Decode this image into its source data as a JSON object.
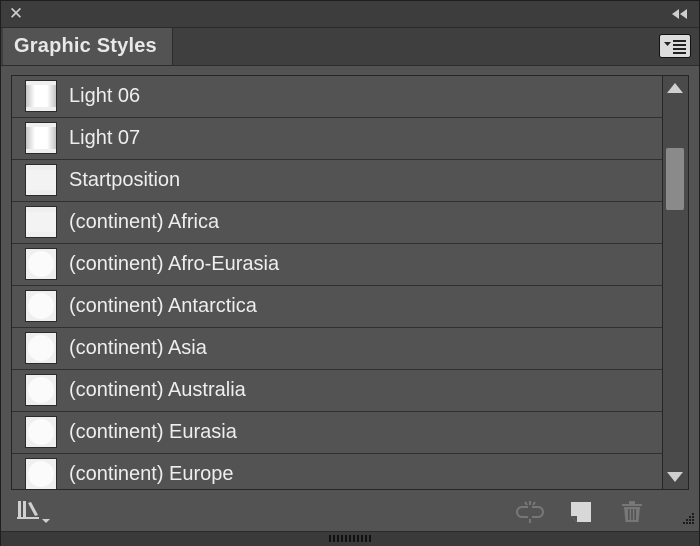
{
  "panel": {
    "tab_title": "Graphic Styles"
  },
  "icons": {
    "close": "close-icon",
    "collapse": "double-chevron-left-icon",
    "menu": "panel-menu-icon",
    "libraries": "graphic-styles-library-icon",
    "break_link": "break-link-icon",
    "new_style": "new-graphic-style-icon",
    "delete": "trash-icon",
    "resize": "resize-grip-icon"
  },
  "styles": [
    {
      "label": "Light 06",
      "swatch": "light"
    },
    {
      "label": "Light 07",
      "swatch": "light"
    },
    {
      "label": "Startposition",
      "swatch": "flat"
    },
    {
      "label": "(continent) Africa",
      "swatch": "flat"
    },
    {
      "label": "(continent) Afro-Eurasia",
      "swatch": "blob"
    },
    {
      "label": "(continent) Antarctica",
      "swatch": "blob"
    },
    {
      "label": "(continent) Asia",
      "swatch": "blob"
    },
    {
      "label": "(continent) Australia",
      "swatch": "blob"
    },
    {
      "label": "(continent) Eurasia",
      "swatch": "blob"
    },
    {
      "label": "(continent) Europe",
      "swatch": "blob"
    }
  ],
  "colors": {
    "panel_bg": "#535353",
    "text": "#eeeeee",
    "disabled_icon": "#777777"
  }
}
